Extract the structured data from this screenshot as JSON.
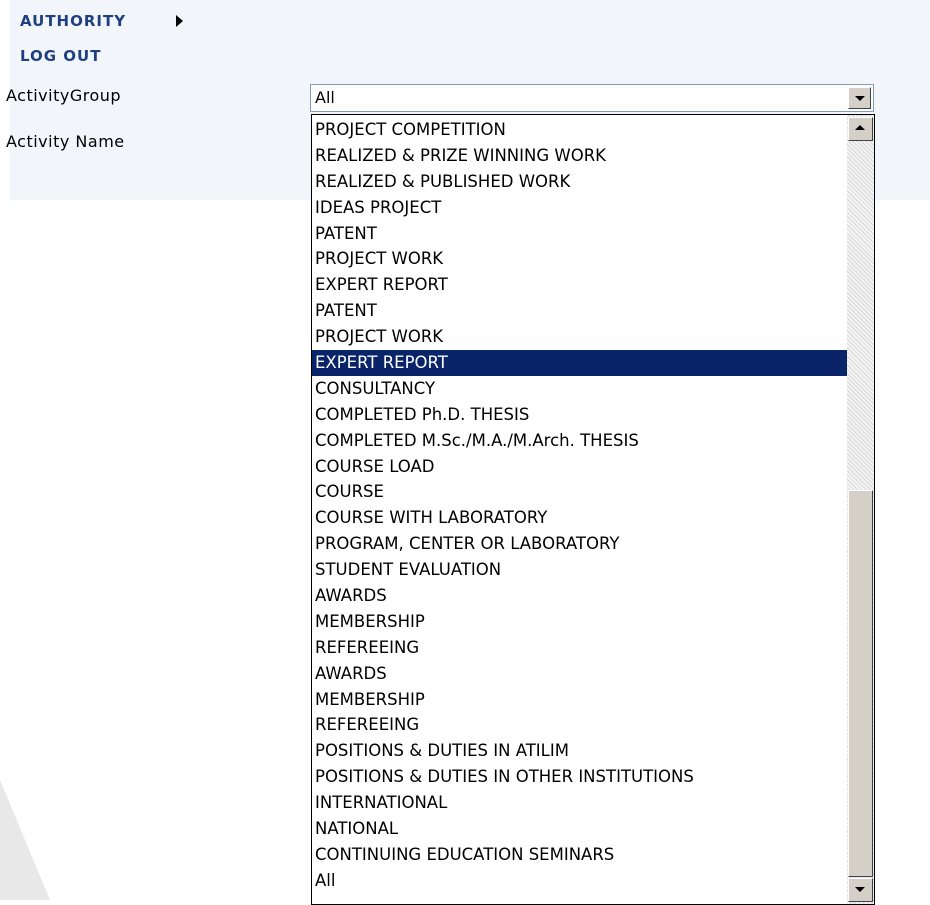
{
  "nav": {
    "authority": "AUTHORITY",
    "logout": "LOG OUT"
  },
  "form": {
    "activity_group_label": "ActivityGroup",
    "activity_name_label": "Activity Name",
    "activity_group_value": "All"
  },
  "dropdown": {
    "options": [
      "PROJECT COMPETITION",
      "REALIZED & PRIZE WINNING WORK",
      "REALIZED & PUBLISHED WORK",
      "IDEAS PROJECT",
      "PATENT",
      "PROJECT WORK",
      "EXPERT REPORT",
      "PATENT",
      "PROJECT WORK",
      "EXPERT REPORT",
      "CONSULTANCY",
      "COMPLETED Ph.D. THESIS",
      "COMPLETED M.Sc./M.A./M.Arch. THESIS",
      "COURSE LOAD",
      "COURSE",
      "COURSE WITH LABORATORY",
      "PROGRAM, CENTER OR LABORATORY",
      "STUDENT EVALUATION",
      "AWARDS",
      "MEMBERSHIP",
      "REFEREEING",
      "AWARDS",
      "MEMBERSHIP",
      "REFEREEING",
      "POSITIONS & DUTIES IN ATILIM",
      "POSITIONS & DUTIES IN OTHER INSTITUTIONS",
      "INTERNATIONAL",
      "NATIONAL",
      "CONTINUING EDUCATION SEMINARS",
      "All"
    ],
    "selected_index": 9,
    "highlight_color": "#0a246a"
  },
  "icons": {
    "nav_arrow": "triangle-right-icon",
    "select_button": "chevron-down-icon",
    "scroll_up": "scroll-up-arrow-icon",
    "scroll_down": "scroll-down-arrow-icon"
  },
  "colors": {
    "nav_link": "#1f3f7f",
    "panel_background": "#f2f6fb"
  }
}
